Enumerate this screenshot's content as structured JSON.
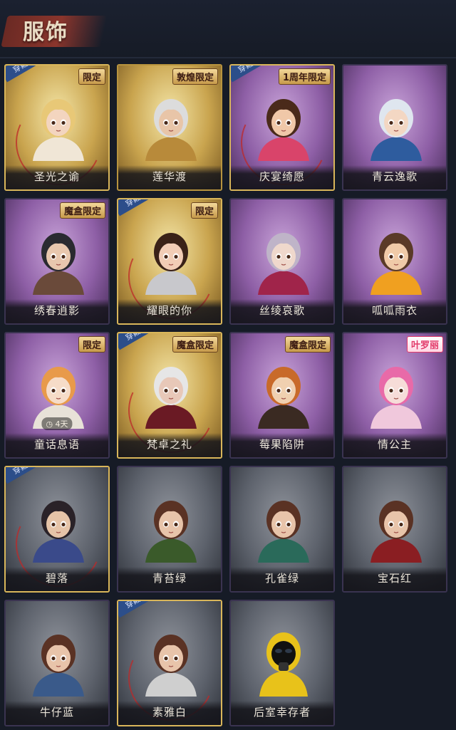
{
  "header": {
    "title": "服饰"
  },
  "labels": {
    "equipped": "穿戴"
  },
  "cards": [
    {
      "name": "圣光之谕",
      "tier": "gold",
      "equipped": true,
      "tag": "限定",
      "hair": "#e8c877",
      "skin": "#f3d5bf",
      "cloth": "#f0e6d6"
    },
    {
      "name": "莲华渡",
      "tier": "gold",
      "equipped": false,
      "tag": "敦煌限定",
      "hair": "#dcdcdc",
      "skin": "#e8c5a8",
      "cloth": "#b88a3a"
    },
    {
      "name": "庆宴绮愿",
      "tier": "purple",
      "equipped": true,
      "tag": "1周年限定",
      "hair": "#4a2a1a",
      "skin": "#f0c8a8",
      "cloth": "#d9446a"
    },
    {
      "name": "青云逸歌",
      "tier": "purple",
      "equipped": false,
      "tag": "",
      "hair": "#dfe6ef",
      "skin": "#f3d7c3",
      "cloth": "#2e5c9e"
    },
    {
      "name": "绣春逍影",
      "tier": "purple",
      "equipped": false,
      "tag": "魔盒限定",
      "hair": "#2a2a30",
      "skin": "#e8c7ae",
      "cloth": "#6a4a3a"
    },
    {
      "name": "耀眼的你",
      "tier": "gold",
      "equipped": true,
      "tag": "限定",
      "hair": "#3a2218",
      "skin": "#f2cdb6",
      "cloth": "#c8c8cc"
    },
    {
      "name": "丝绫哀歌",
      "tier": "purple",
      "equipped": false,
      "tag": "",
      "hair": "#bfb4c8",
      "skin": "#efd8cc",
      "cloth": "#a0244a"
    },
    {
      "name": "呱呱雨衣",
      "tier": "purple",
      "equipped": false,
      "tag": "",
      "hair": "#5a3a28",
      "skin": "#f0caa8",
      "cloth": "#f0a020"
    },
    {
      "name": "童话息语",
      "tier": "purple",
      "equipped": false,
      "tag": "限定",
      "timer": "4天",
      "hair": "#e89a4a",
      "skin": "#f6dcc8",
      "cloth": "#e8e2d8"
    },
    {
      "name": "梵卓之礼",
      "tier": "gold",
      "equipped": true,
      "tag": "魔盒限定",
      "hair": "#e6e6e6",
      "skin": "#e8c8b8",
      "cloth": "#6a1a24"
    },
    {
      "name": "莓果陷阱",
      "tier": "purple",
      "equipped": false,
      "tag": "魔盒限定",
      "hair": "#c86a2a",
      "skin": "#f0d0b0",
      "cloth": "#3a2a22"
    },
    {
      "name": "情公主",
      "tier": "purple",
      "equipped": false,
      "tag": "叶罗丽",
      "tagStyle": "pink",
      "hair": "#e86aa8",
      "skin": "#f6dcd8",
      "cloth": "#f0c8dc"
    },
    {
      "name": "碧落",
      "tier": "gray",
      "equipped": true,
      "tag": "",
      "hair": "#2a2228",
      "skin": "#e6c4a8",
      "cloth": "#3a4a8a"
    },
    {
      "name": "青苔绿",
      "tier": "gray",
      "equipped": false,
      "tag": "",
      "hair": "#5a3224",
      "skin": "#e8c4aa",
      "cloth": "#3a5a2a"
    },
    {
      "name": "孔雀绿",
      "tier": "gray",
      "equipped": false,
      "tag": "",
      "hair": "#5a3224",
      "skin": "#e8c4aa",
      "cloth": "#2a6a5a"
    },
    {
      "name": "宝石红",
      "tier": "gray",
      "equipped": false,
      "tag": "",
      "hair": "#5a3224",
      "skin": "#e8c4aa",
      "cloth": "#8a1e22"
    },
    {
      "name": "牛仔蓝",
      "tier": "gray",
      "equipped": false,
      "tag": "",
      "hair": "#5a3224",
      "skin": "#e8c4aa",
      "cloth": "#3a5a8a"
    },
    {
      "name": "素雅白",
      "tier": "gray",
      "equipped": true,
      "tag": "",
      "hair": "#5a3224",
      "skin": "#e8c4aa",
      "cloth": "#cfcfcf"
    },
    {
      "name": "后室幸存者",
      "tier": "gray",
      "equipped": false,
      "tag": "",
      "hazmat": true,
      "hair": "#1a1a1a",
      "skin": "#2a2a2a",
      "cloth": "#e8c21a"
    }
  ]
}
